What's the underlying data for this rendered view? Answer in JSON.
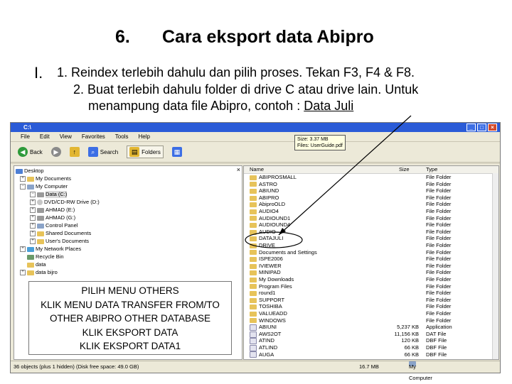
{
  "slide": {
    "number": "6.",
    "title": "Cara eksport data Abipro",
    "roman": "I.",
    "line1": "1. Reindex terlebih dahulu dan pilih proses. Tekan F3, F4 & F8.",
    "line2": "2. Buat terlebih dahulu folder di drive C atau drive lain. Untuk",
    "line3_prefix": "menampung data file Abipro, contoh : ",
    "line3_link": "Data Juli"
  },
  "window": {
    "title": "C:\\",
    "menu": [
      "File",
      "Edit",
      "View",
      "Favorites",
      "Tools",
      "Help"
    ],
    "toolbar": {
      "back": "Back",
      "search": "Search",
      "folders": "Folders"
    },
    "tree": [
      "Desktop",
      "My Documents",
      "My Computer",
      "Data (C:)",
      "DVD/CD-RW Drive (D:)",
      "AHMAD (E:)",
      "AHMAD (G:)",
      "Control Panel",
      "Shared Documents",
      "User's Documents",
      "My Network Places",
      "Recycle Bin",
      "data",
      "data bijro"
    ],
    "columns": {
      "name": "Name",
      "size": "Size",
      "type": "Type"
    },
    "files": [
      {
        "name": "ABIPROSMALL",
        "size": "",
        "type": "File Folder"
      },
      {
        "name": "ASTRO",
        "size": "",
        "type": "File Folder"
      },
      {
        "name": "ABIUND",
        "size": "",
        "type": "File Folder"
      },
      {
        "name": "ABIPRO",
        "size": "",
        "type": "File Folder"
      },
      {
        "name": "AbiproOLD",
        "size": "",
        "type": "File Folder"
      },
      {
        "name": "AUDIO4",
        "size": "",
        "type": "File Folder"
      },
      {
        "name": "AUDIOUND1",
        "size": "",
        "type": "File Folder"
      },
      {
        "name": "AUDIOUND4",
        "size": "",
        "type": "File Folder"
      },
      {
        "name": "AUDIO",
        "size": "",
        "type": "File Folder"
      },
      {
        "name": "DATAJULI",
        "size": "",
        "type": "File Folder"
      },
      {
        "name": "DRIVE",
        "size": "",
        "type": "File Folder"
      },
      {
        "name": "Documents and Settings",
        "size": "",
        "type": "File Folder"
      },
      {
        "name": "ISPE2006",
        "size": "",
        "type": "File Folder"
      },
      {
        "name": "IVIEWER",
        "size": "",
        "type": "File Folder"
      },
      {
        "name": "MINIPAD",
        "size": "",
        "type": "File Folder"
      },
      {
        "name": "My Downloads",
        "size": "",
        "type": "File Folder"
      },
      {
        "name": "Program Files",
        "size": "",
        "type": "File Folder"
      },
      {
        "name": "round1",
        "size": "",
        "type": "File Folder"
      },
      {
        "name": "SUPPORT",
        "size": "",
        "type": "File Folder"
      },
      {
        "name": "TOSHIBA",
        "size": "",
        "type": "File Folder"
      },
      {
        "name": "VALUEADD",
        "size": "",
        "type": "File Folder"
      },
      {
        "name": "WINDOWS",
        "size": "",
        "type": "File Folder"
      },
      {
        "name": "ABIUNI",
        "size": "5,237 KB",
        "type": "Application"
      },
      {
        "name": "AWS2OT",
        "size": "11,156 KB",
        "type": "DAT File"
      },
      {
        "name": "ATIND",
        "size": "120 KB",
        "type": "DBF File"
      },
      {
        "name": "ATLIND",
        "size": "66 KB",
        "type": "DBF File"
      },
      {
        "name": "AUGA",
        "size": "66 KB",
        "type": "DBF File"
      }
    ],
    "tooltip": {
      "size": "Size: 3.37 MB",
      "files": "Files: UserGuide.pdf"
    },
    "status": {
      "objects": "36 objects (plus 1 hidden) (Disk free space: 49.0 GB)",
      "size": "16.7 MB",
      "location": "My Computer"
    }
  },
  "callout": [
    "PILIH MENU OTHERS",
    "KLIK MENU DATA TRANSFER FROM/TO",
    "OTHER ABIPRO OTHER DATABASE",
    "KLIK EKSPORT DATA",
    "KLIK EKSPORT DATA1"
  ],
  "colors": {
    "titlebar": "#2a5bd7",
    "chrome": "#ece9d8",
    "folder": "#e7c35a"
  }
}
